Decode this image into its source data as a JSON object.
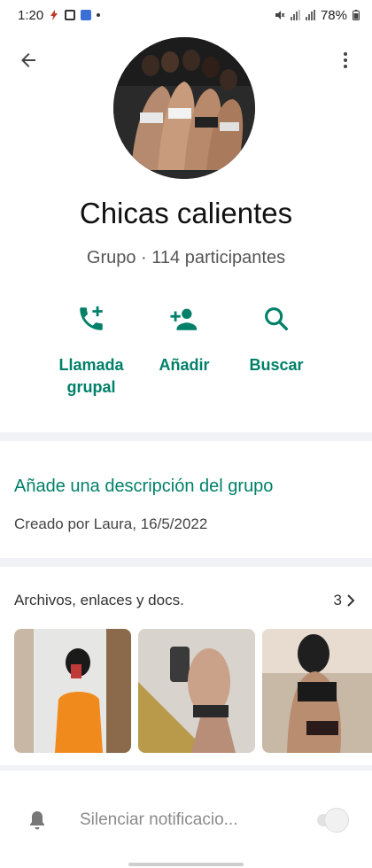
{
  "status_bar": {
    "time": "1:20",
    "battery": "78%"
  },
  "header": {
    "back_icon": "arrow-left-icon",
    "menu_icon": "more-vert-icon"
  },
  "group": {
    "name": "Chicas calientes",
    "meta": "Grupo · 114 participantes"
  },
  "actions": [
    {
      "icon": "phone-add-icon",
      "label_line1": "Llamada",
      "label_line2": "grupal"
    },
    {
      "icon": "person-add-icon",
      "label_line1": "Añadir"
    },
    {
      "icon": "search-icon",
      "label_line1": "Buscar"
    }
  ],
  "description": {
    "add_link": "Añade una descripción del grupo",
    "created_by": "Creado por Laura, 16/5/2022"
  },
  "files": {
    "title": "Archivos, enlaces y docs.",
    "count": "3"
  },
  "mute": {
    "label": "Silenciar notificacio...",
    "enabled": false
  },
  "colors": {
    "accent": "#008069",
    "background": "#ffffff",
    "separator": "#f0f2f5"
  }
}
